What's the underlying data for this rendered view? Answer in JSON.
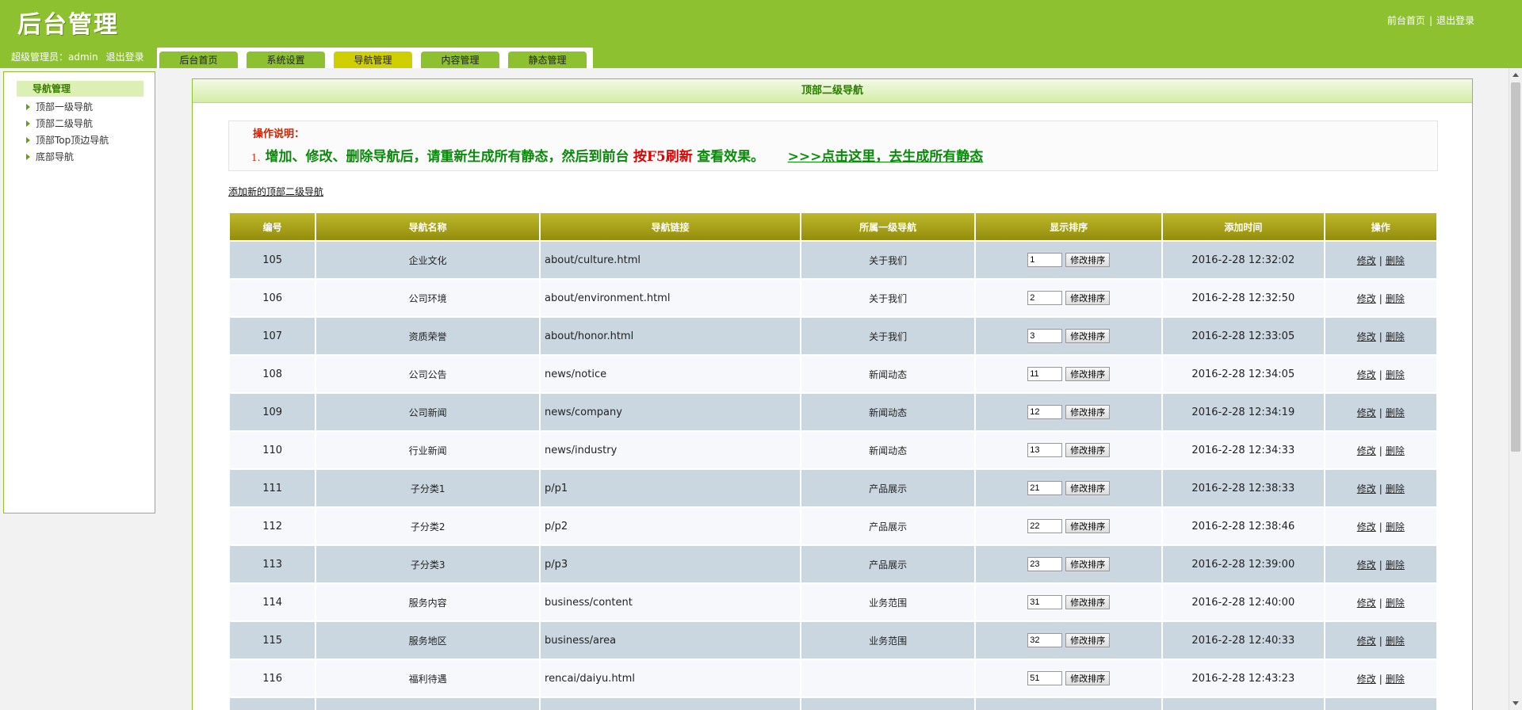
{
  "header": {
    "logo": "后台管理",
    "links": {
      "home": "前台首页",
      "sep": "|",
      "logout": "退出登录"
    },
    "user": {
      "label": "超级管理员：admin",
      "logout": "退出登录"
    },
    "tabs": [
      {
        "label": "后台首页",
        "active": false
      },
      {
        "label": "系统设置",
        "active": false
      },
      {
        "label": "导航管理",
        "active": true
      },
      {
        "label": "内容管理",
        "active": false
      },
      {
        "label": "静态管理",
        "active": false
      }
    ]
  },
  "sidebar": {
    "title": "导航管理",
    "items": [
      {
        "label": "顶部一级导航"
      },
      {
        "label": "顶部二级导航"
      },
      {
        "label": "顶部Top顶边导航"
      },
      {
        "label": "底部导航"
      }
    ]
  },
  "main": {
    "title": "顶部二级导航",
    "notice": {
      "label": "操作说明：",
      "num": "1.",
      "text1": "增加、修改、删除导航后，请重新生成所有静态，然后到前台",
      "text2": "按F5刷新",
      "text3": "查看效果。",
      "link": ">>>点击这里，去生成所有静态"
    },
    "add_link": "添加新的顶部二级导航",
    "table": {
      "headers": [
        "编号",
        "导航名称",
        "导航链接",
        "所属一级导航",
        "显示排序",
        "添加时间",
        "操作"
      ],
      "btn_label": "修改排序",
      "edit_label": "修改",
      "delete_label": "删除",
      "op_sep": "|",
      "rows": [
        {
          "id": "105",
          "name": "企业文化",
          "link": "about/culture.html",
          "parent": "关于我们",
          "sort": "1",
          "time": "2016-2-28 12:32:02"
        },
        {
          "id": "106",
          "name": "公司环境",
          "link": "about/environment.html",
          "parent": "关于我们",
          "sort": "2",
          "time": "2016-2-28 12:32:50"
        },
        {
          "id": "107",
          "name": "资质荣誉",
          "link": "about/honor.html",
          "parent": "关于我们",
          "sort": "3",
          "time": "2016-2-28 12:33:05"
        },
        {
          "id": "108",
          "name": "公司公告",
          "link": "news/notice",
          "parent": "新闻动态",
          "sort": "11",
          "time": "2016-2-28 12:34:05"
        },
        {
          "id": "109",
          "name": "公司新闻",
          "link": "news/company",
          "parent": "新闻动态",
          "sort": "12",
          "time": "2016-2-28 12:34:19"
        },
        {
          "id": "110",
          "name": "行业新闻",
          "link": "news/industry",
          "parent": "新闻动态",
          "sort": "13",
          "time": "2016-2-28 12:34:33"
        },
        {
          "id": "111",
          "name": "子分类1",
          "link": "p/p1",
          "parent": "产品展示",
          "sort": "21",
          "time": "2016-2-28 12:38:33"
        },
        {
          "id": "112",
          "name": "子分类2",
          "link": "p/p2",
          "parent": "产品展示",
          "sort": "22",
          "time": "2016-2-28 12:38:46"
        },
        {
          "id": "113",
          "name": "子分类3",
          "link": "p/p3",
          "parent": "产品展示",
          "sort": "23",
          "time": "2016-2-28 12:39:00"
        },
        {
          "id": "114",
          "name": "服务内容",
          "link": "business/content",
          "parent": "业务范围",
          "sort": "31",
          "time": "2016-2-28 12:40:00"
        },
        {
          "id": "115",
          "name": "服务地区",
          "link": "business/area",
          "parent": "业务范围",
          "sort": "32",
          "time": "2016-2-28 12:40:33"
        },
        {
          "id": "116",
          "name": "福利待遇",
          "link": "rencai/daiyu.html",
          "parent": "",
          "sort": "51",
          "time": "2016-2-28 12:43:23"
        },
        {
          "id": "",
          "name": "",
          "link": "",
          "parent": "",
          "sort": "",
          "time": ""
        }
      ]
    }
  }
}
